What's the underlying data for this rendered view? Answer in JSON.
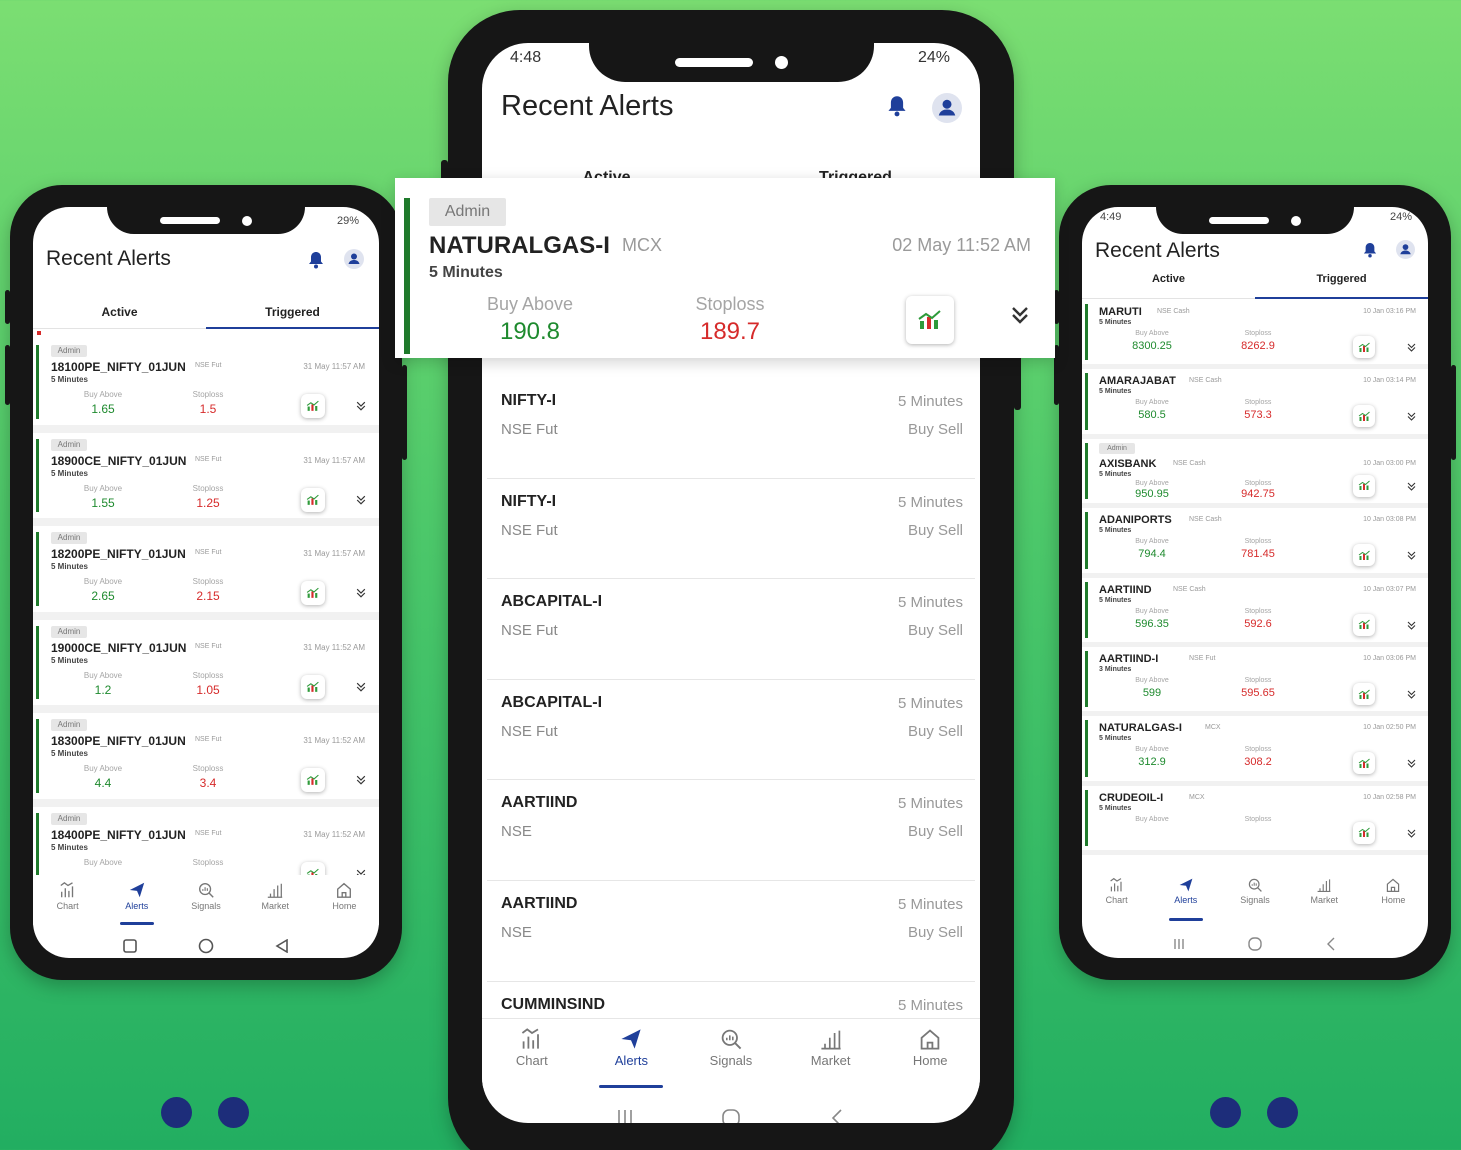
{
  "colors": {
    "accent": "#1f3f9a",
    "buy": "#1e8a2e",
    "stoploss": "#d62b2b",
    "stripe": "#1f7a2b",
    "bg_top": "#7bde72",
    "bg_bottom": "#22ae61",
    "dots": "#1d2d7a"
  },
  "common": {
    "title": "Recent Alerts",
    "tab_active": "Active",
    "tab_triggered": "Triggered",
    "buy_label": "Buy Above",
    "sl_label": "Stoploss",
    "admin": "Admin",
    "nav": [
      {
        "label": "Chart",
        "icon": "chart-icon"
      },
      {
        "label": "Alerts",
        "icon": "paper-plane-icon"
      },
      {
        "label": "Signals",
        "icon": "search-signal-icon"
      },
      {
        "label": "Market",
        "icon": "market-icon"
      },
      {
        "label": "Home",
        "icon": "home-icon"
      }
    ]
  },
  "left_phone": {
    "status": "29%",
    "selected_tab": "Triggered",
    "alerts": [
      {
        "symbol": "18100PE_NIFTY_01JUN",
        "exchange": "NSE Fut",
        "timeframe": "5 Minutes",
        "time": "31 May 11:57 AM",
        "buy": "1.65",
        "sl": "1.5"
      },
      {
        "symbol": "18900CE_NIFTY_01JUN",
        "exchange": "NSE Fut",
        "timeframe": "5 Minutes",
        "time": "31 May 11:57 AM",
        "buy": "1.55",
        "sl": "1.25"
      },
      {
        "symbol": "18200PE_NIFTY_01JUN",
        "exchange": "NSE Fut",
        "timeframe": "5 Minutes",
        "time": "31 May 11:57 AM",
        "buy": "2.65",
        "sl": "2.15"
      },
      {
        "symbol": "19000CE_NIFTY_01JUN",
        "exchange": "NSE Fut",
        "timeframe": "5 Minutes",
        "time": "31 May 11:52 AM",
        "buy": "1.2",
        "sl": "1.05"
      },
      {
        "symbol": "18300PE_NIFTY_01JUN",
        "exchange": "NSE Fut",
        "timeframe": "5 Minutes",
        "time": "31 May 11:52 AM",
        "buy": "4.4",
        "sl": "3.4"
      },
      {
        "symbol": "18400PE_NIFTY_01JUN",
        "exchange": "NSE Fut",
        "timeframe": "5 Minutes",
        "time": "31 May 11:52 AM",
        "buy": "",
        "sl": ""
      }
    ]
  },
  "center_phone": {
    "status_time": "4:48",
    "status": "24%",
    "selected_tab": "Active",
    "featured": {
      "admin": "Admin",
      "symbol": "NATURALGAS-I",
      "exchange": "MCX",
      "timeframe": "5 Minutes",
      "time": "02 May 11:52 AM",
      "buy_label": "Buy Above",
      "buy": "190.8",
      "sl_label": "Stoploss",
      "sl": "189.7"
    },
    "rows": [
      {
        "symbol": "NIFTY-I",
        "exchange": "NSE Fut",
        "timeframe": "5 Minutes",
        "side": "Buy Sell"
      },
      {
        "symbol": "NIFTY-I",
        "exchange": "NSE Fut",
        "timeframe": "5 Minutes",
        "side": "Buy Sell"
      },
      {
        "symbol": "ABCAPITAL-I",
        "exchange": "NSE Fut",
        "timeframe": "5 Minutes",
        "side": "Buy Sell"
      },
      {
        "symbol": "ABCAPITAL-I",
        "exchange": "NSE Fut",
        "timeframe": "5 Minutes",
        "side": "Buy Sell"
      },
      {
        "symbol": "AARTIIND",
        "exchange": "NSE",
        "timeframe": "5 Minutes",
        "side": "Buy Sell"
      },
      {
        "symbol": "AARTIIND",
        "exchange": "NSE",
        "timeframe": "5 Minutes",
        "side": "Buy Sell"
      },
      {
        "symbol": "CUMMINSIND",
        "exchange": "",
        "timeframe": "5 Minutes",
        "side": ""
      }
    ]
  },
  "right_phone": {
    "status_time": "4:49",
    "status": "24%",
    "selected_tab": "Triggered",
    "alerts": [
      {
        "admin": false,
        "symbol": "MARUTI",
        "exchange": "NSE Cash",
        "timeframe": "5 Minutes",
        "time": "10 Jan 03:16 PM",
        "buy": "8300.25",
        "sl": "8262.9"
      },
      {
        "admin": false,
        "symbol": "AMARAJABAT",
        "exchange": "NSE Cash",
        "timeframe": "5 Minutes",
        "time": "10 Jan 03:14 PM",
        "buy": "580.5",
        "sl": "573.3"
      },
      {
        "admin": true,
        "symbol": "AXISBANK",
        "exchange": "NSE Cash",
        "timeframe": "5 Minutes",
        "time": "10 Jan 03:00 PM",
        "buy": "950.95",
        "sl": "942.75"
      },
      {
        "admin": false,
        "symbol": "ADANIPORTS",
        "exchange": "NSE Cash",
        "timeframe": "5 Minutes",
        "time": "10 Jan 03:08 PM",
        "buy": "794.4",
        "sl": "781.45"
      },
      {
        "admin": false,
        "symbol": "AARTIIND",
        "exchange": "NSE Cash",
        "timeframe": "5 Minutes",
        "time": "10 Jan 03:07 PM",
        "buy": "596.35",
        "sl": "592.6"
      },
      {
        "admin": false,
        "symbol": "AARTIIND-I",
        "exchange": "NSE Fut",
        "timeframe": "3 Minutes",
        "time": "10 Jan 03:06 PM",
        "buy": "599",
        "sl": "595.65"
      },
      {
        "admin": false,
        "symbol": "NATURALGAS-I",
        "exchange": "MCX",
        "timeframe": "5 Minutes",
        "time": "10 Jan 02:50 PM",
        "buy": "312.9",
        "sl": "308.2"
      },
      {
        "admin": false,
        "symbol": "CRUDEOIL-I",
        "exchange": "MCX",
        "timeframe": "5 Minutes",
        "time": "10 Jan 02:58 PM",
        "buy": "",
        "sl": ""
      }
    ]
  }
}
